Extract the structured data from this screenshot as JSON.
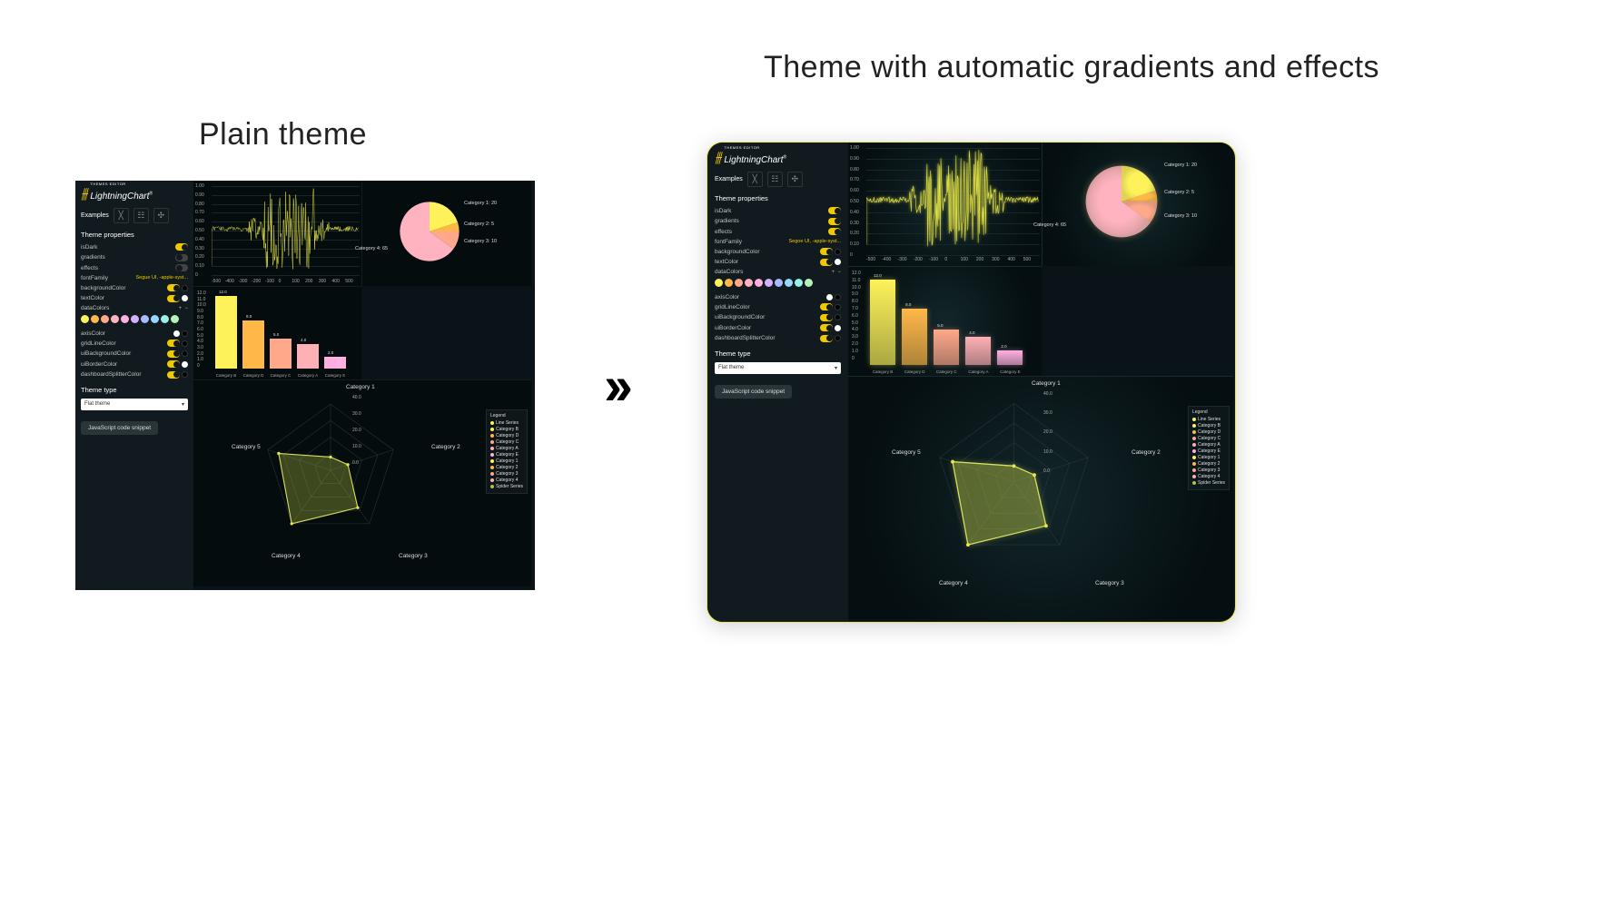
{
  "titles": {
    "left": "Plain theme",
    "right": "Theme with automatic gradients and effects"
  },
  "app": {
    "name": "LightningChart",
    "badge": "THEMES EDITOR",
    "trademark": "®",
    "examples_label": "Examples"
  },
  "sidebar": {
    "props_heading": "Theme properties",
    "plain": [
      {
        "name": "isDark",
        "on": true
      },
      {
        "name": "gradients",
        "on": false
      },
      {
        "name": "effects",
        "on": false
      },
      {
        "name": "fontFamily",
        "accent": "Segue UI, -apple-syst..."
      },
      {
        "name": "backgroundColor",
        "on": true,
        "swatch": "blk"
      },
      {
        "name": "textColor",
        "on": true,
        "swatch": "wht"
      }
    ],
    "grad": [
      {
        "name": "isDark",
        "on": true
      },
      {
        "name": "gradients",
        "on": true
      },
      {
        "name": "effects",
        "on": true
      },
      {
        "name": "fontFamily",
        "accent": "Segoe UI, -apple-syst..."
      },
      {
        "name": "backgroundColor",
        "on": true,
        "swatch": "blk"
      },
      {
        "name": "textColor",
        "on": true,
        "swatch": "wht"
      }
    ],
    "data_colors_label": "dataColors",
    "palette": [
      "#fdf25a",
      "#ffb848",
      "#ffa88a",
      "#ffb2bf",
      "#ffb0e0",
      "#d3b1ff",
      "#aab8ff",
      "#96d6ff",
      "#99f0e7",
      "#b8f0b8"
    ],
    "below": [
      {
        "name": "axisColor",
        "swatches": [
          "wht",
          "blk"
        ]
      },
      {
        "name": "gridLineColor",
        "on": true,
        "swatch": "blk"
      },
      {
        "name": "uiBackgroundColor",
        "on": true,
        "swatch": "blk"
      },
      {
        "name": "uiBorderColor",
        "on": true,
        "swatch": "wht"
      },
      {
        "name": "dashboardSplitterColor",
        "on": true,
        "swatch": "blk"
      }
    ],
    "type_heading": "Theme type",
    "type_value": "Flat theme",
    "snippet": "JavaScript code snippet"
  },
  "chart_data": {
    "line": {
      "type": "line",
      "ylabels": [
        "1.00",
        "0.90",
        "0.80",
        "0.70",
        "0.60",
        "0.50",
        "0.40",
        "0.30",
        "0.20",
        "0.10",
        "0"
      ],
      "xlabels": [
        "-500",
        "-400",
        "-300",
        "-200",
        "-100",
        "0",
        "100",
        "200",
        "300",
        "400",
        "500"
      ],
      "ylim": [
        0,
        1
      ]
    },
    "pie": {
      "type": "pie",
      "slices": [
        {
          "label": "Category 1: 20",
          "start": -90,
          "sweep": 72,
          "c": "#fdf25a"
        },
        {
          "label": "Category 2: 5",
          "start": -18,
          "sweep": 18,
          "c": "#ffb848"
        },
        {
          "label": "Category 3: 10",
          "start": 0,
          "sweep": 36,
          "c": "#ffa88a"
        },
        {
          "label": "Category 4: 65",
          "start": 36,
          "sweep": 234,
          "c": "#ffb2bf"
        }
      ]
    },
    "bar": {
      "type": "bar",
      "categories": [
        "Category B",
        "Category D",
        "Category C",
        "Category A",
        "Category E"
      ],
      "values": [
        12.0,
        8.0,
        5.0,
        4.0,
        2.0
      ],
      "ylim": [
        0,
        12
      ],
      "yticks": [
        "12.0",
        "11.0",
        "10.0",
        "9.0",
        "8.0",
        "7.0",
        "6.0",
        "5.0",
        "4.0",
        "3.0",
        "2.0",
        "1.0",
        "0"
      ],
      "colors": [
        "#fdf25a",
        "#ffb848",
        "#ffa88a",
        "#ffb0b4",
        "#ffb0e0"
      ]
    },
    "spider": {
      "type": "spider",
      "categories": [
        "Category 1",
        "Category 2",
        "Category 3",
        "Category 4",
        "Category 5"
      ],
      "ticks": [
        "40.0",
        "30.0",
        "20.0",
        "10.0",
        "0.0"
      ],
      "values": [
        8,
        11,
        28,
        40,
        33
      ]
    }
  },
  "legend": {
    "heading": "Legend",
    "items": [
      [
        "Line Series",
        "#fdf25a"
      ],
      [
        "Category B",
        "#fdf25a"
      ],
      [
        "Category D",
        "#ffb848"
      ],
      [
        "Category C",
        "#ffa88a"
      ],
      [
        "Category A",
        "#ffb0b4"
      ],
      [
        "Category E",
        "#ffb0e0"
      ],
      [
        "Category 1",
        "#fdf25a"
      ],
      [
        "Category 2",
        "#ffb848"
      ],
      [
        "Category 3",
        "#ffa88a"
      ],
      [
        "Category 4",
        "#ffb0b4"
      ],
      [
        "Spider Series",
        "#b0c040"
      ]
    ]
  }
}
